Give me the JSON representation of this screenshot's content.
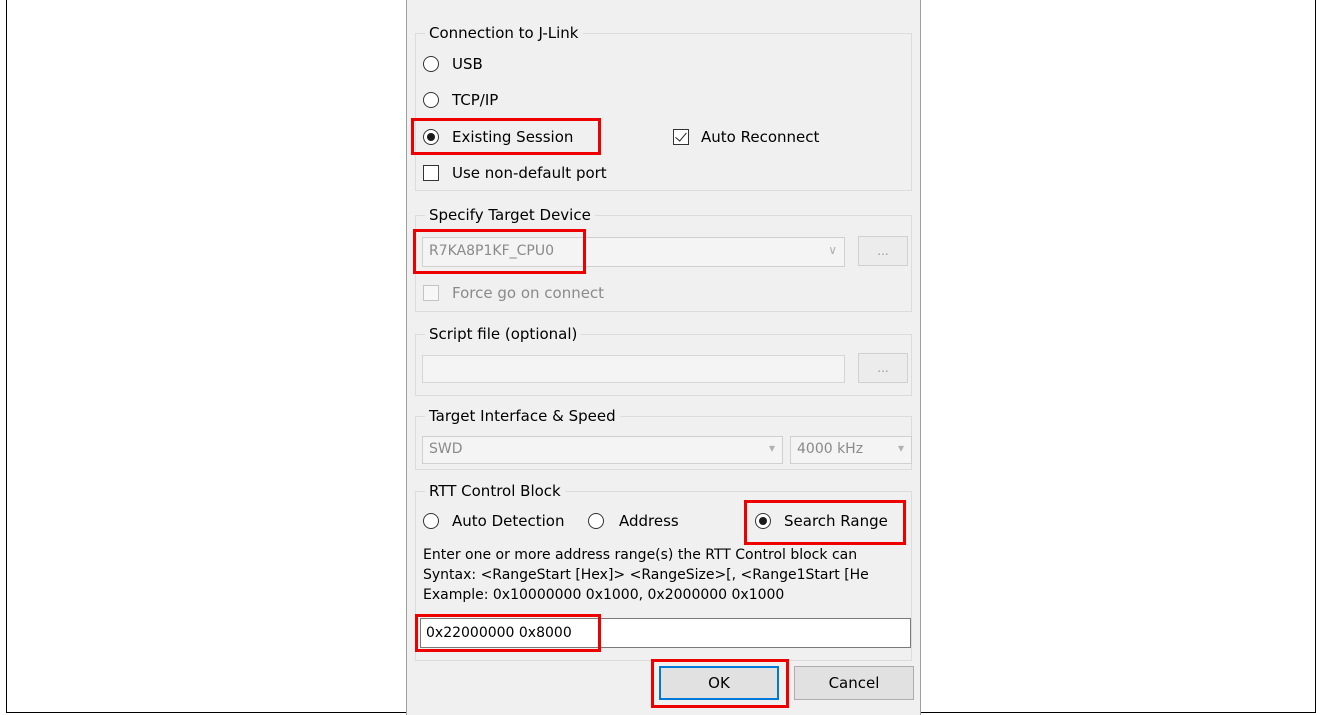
{
  "connection": {
    "title": "Connection to J-Link",
    "usb": "USB",
    "tcpip": "TCP/IP",
    "existing_session": "Existing Session",
    "auto_reconnect": "Auto Reconnect",
    "use_non_default_port": "Use non-default port",
    "selected": "Existing Session",
    "auto_reconnect_checked": true,
    "non_default_port_checked": false
  },
  "target_device": {
    "title": "Specify Target Device",
    "device": "R7KA8P1KF_CPU0",
    "browse_label": "...",
    "force_go": "Force go on connect"
  },
  "script_file": {
    "title": "Script file (optional)",
    "value": "",
    "browse_label": "..."
  },
  "interface": {
    "title": "Target Interface & Speed",
    "interface": "SWD",
    "speed": "4000 kHz"
  },
  "rtt": {
    "title": "RTT Control Block",
    "auto_detection": "Auto Detection",
    "address": "Address",
    "search_range": "Search Range",
    "selected": "Search Range",
    "help_line1": "Enter one or more address range(s) the RTT Control block can",
    "help_line2": "Syntax: <RangeStart [Hex]> <RangeSize>[, <Range1Start [He",
    "help_line3": "Example: 0x10000000 0x1000, 0x2000000 0x1000",
    "range_value": "0x22000000 0x8000"
  },
  "buttons": {
    "ok": "OK",
    "cancel": "Cancel"
  },
  "colors": {
    "highlight": "#ee0000",
    "default_button_border": "#0078d7",
    "dialog_bg": "#f0f0f0"
  }
}
